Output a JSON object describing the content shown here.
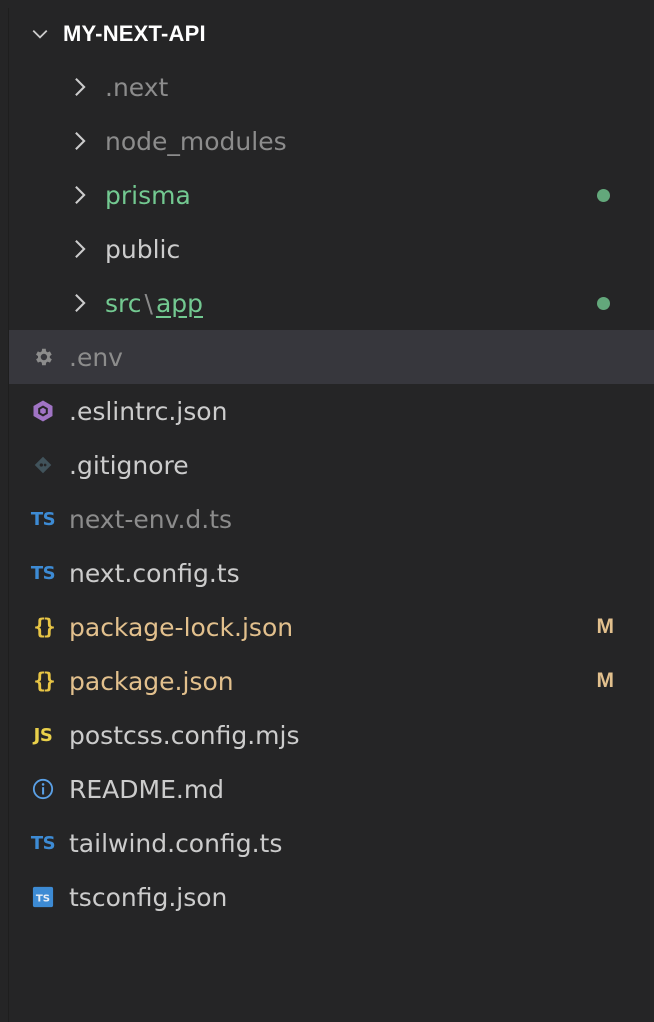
{
  "explorer": {
    "root_title": "MY-NEXT-API",
    "folders": [
      {
        "label": ".next",
        "color": "#8c8c8c"
      },
      {
        "label": "node_modules",
        "color": "#8c8c8c"
      },
      {
        "label": "prisma",
        "color": "#73c991",
        "badge": "dot"
      },
      {
        "label": "public",
        "color": "#cccccc"
      },
      {
        "label_parent": "src",
        "separator": "\\",
        "label_child": "app",
        "color": "#73c991",
        "badge": "dot"
      }
    ],
    "files": [
      {
        "label": ".env",
        "icon": "gear-icon",
        "color": "#8c8c8c",
        "selected": true
      },
      {
        "label": ".eslintrc.json",
        "icon": "eslint-icon",
        "color": "#cccccc"
      },
      {
        "label": ".gitignore",
        "icon": "git-icon",
        "color": "#cccccc"
      },
      {
        "label": "next-env.d.ts",
        "icon": "typescript-icon",
        "icon_text": "TS",
        "color": "#8c8c8c"
      },
      {
        "label": "next.config.ts",
        "icon": "typescript-icon",
        "icon_text": "TS",
        "color": "#cccccc"
      },
      {
        "label": "package-lock.json",
        "icon": "json-icon",
        "icon_text": "{}",
        "color": "#e2c08d",
        "badge": "M"
      },
      {
        "label": "package.json",
        "icon": "json-icon",
        "icon_text": "{}",
        "color": "#e2c08d",
        "badge": "M"
      },
      {
        "label": "postcss.config.mjs",
        "icon": "javascript-icon",
        "icon_text": "JS",
        "color": "#cccccc"
      },
      {
        "label": "README.md",
        "icon": "info-icon",
        "color": "#cccccc"
      },
      {
        "label": "tailwind.config.ts",
        "icon": "typescript-icon",
        "icon_text": "TS",
        "color": "#cccccc"
      },
      {
        "label": "tsconfig.json",
        "icon": "tsconfig-icon",
        "icon_text": "TS",
        "color": "#cccccc"
      }
    ]
  }
}
